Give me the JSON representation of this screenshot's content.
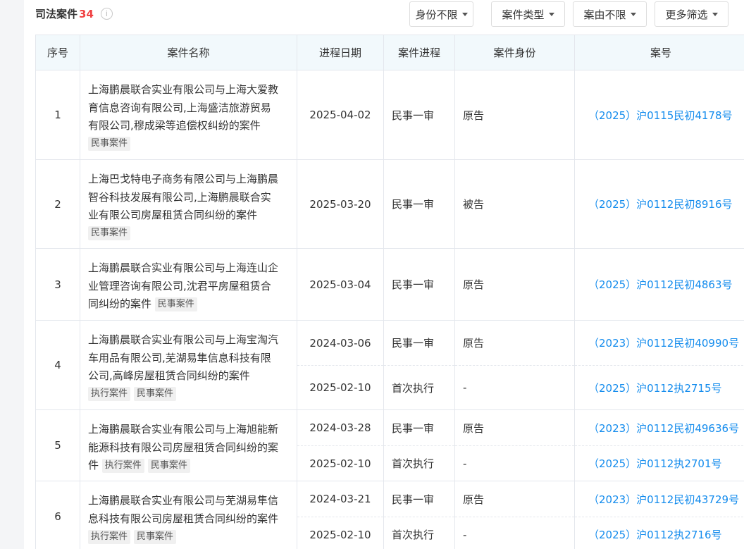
{
  "header": {
    "title": "司法案件",
    "count": "34",
    "info_icon": "i",
    "filters": [
      "身份不限",
      "案件类型",
      "案由不限",
      "更多筛选"
    ]
  },
  "columns": [
    "序号",
    "案件名称",
    "进程日期",
    "案件进程",
    "案件身份",
    "案号"
  ],
  "rows": [
    {
      "index": "1",
      "name_lines": [
        "上海鹏晨联合实业有限公司与上海大爱教",
        "育信息咨询有限公司,上海盛洁旅游贸易",
        "有限公司,穆成梁等追偿权纠纷的案件"
      ],
      "tags": [
        "民事案件"
      ],
      "records": [
        {
          "date": "2025-04-02",
          "progress": "民事一审",
          "role": "原告",
          "case_no": "（2025）沪0115民初4178号"
        }
      ]
    },
    {
      "index": "2",
      "name_lines": [
        "上海巴戈特电子商务有限公司与上海鹏晨",
        "智谷科技发展有限公司,上海鹏晨联合实",
        "业有限公司房屋租赁合同纠纷的案件"
      ],
      "tags": [
        "民事案件"
      ],
      "records": [
        {
          "date": "2025-03-20",
          "progress": "民事一审",
          "role": "被告",
          "case_no": "（2025）沪0112民初8916号"
        }
      ]
    },
    {
      "index": "3",
      "name_lines": [
        "上海鹏晨联合实业有限公司与上海连山企",
        "业管理咨询有限公司,沈君平房屋租赁合",
        "同纠纷的案件"
      ],
      "tags": [
        "民事案件"
      ],
      "records": [
        {
          "date": "2025-03-04",
          "progress": "民事一审",
          "role": "原告",
          "case_no": "（2025）沪0112民初4863号"
        }
      ]
    },
    {
      "index": "4",
      "name_lines": [
        "上海鹏晨联合实业有限公司与上海宝淘汽",
        "车用品有限公司,芜湖易隼信息科技有限",
        "公司,高峰房屋租赁合同纠纷的案件"
      ],
      "tags": [
        "执行案件",
        "民事案件"
      ],
      "records": [
        {
          "date": "2024-03-06",
          "progress": "民事一审",
          "role": "原告",
          "case_no": "（2023）沪0112民初40990号"
        },
        {
          "date": "2025-02-10",
          "progress": "首次执行",
          "role": "-",
          "case_no": "（2025）沪0112执2715号"
        }
      ]
    },
    {
      "index": "5",
      "name_lines": [
        "上海鹏晨联合实业有限公司与上海旭能新",
        "能源科技有限公司房屋租赁合同纠纷的案",
        "件"
      ],
      "tags": [
        "执行案件",
        "民事案件"
      ],
      "records": [
        {
          "date": "2024-03-28",
          "progress": "民事一审",
          "role": "原告",
          "case_no": "（2023）沪0112民初49636号"
        },
        {
          "date": "2025-02-10",
          "progress": "首次执行",
          "role": "-",
          "case_no": "（2025）沪0112执2701号"
        }
      ]
    },
    {
      "index": "6",
      "name_lines": [
        "上海鹏晨联合实业有限公司与芜湖易隼信",
        "息科技有限公司房屋租赁合同纠纷的案件"
      ],
      "tags": [
        "执行案件",
        "民事案件"
      ],
      "records": [
        {
          "date": "2024-03-21",
          "progress": "民事一审",
          "role": "原告",
          "case_no": "（2023）沪0112民初43729号"
        },
        {
          "date": "2025-02-10",
          "progress": "首次执行",
          "role": "-",
          "case_no": "（2025）沪0112执2716号"
        }
      ]
    }
  ]
}
